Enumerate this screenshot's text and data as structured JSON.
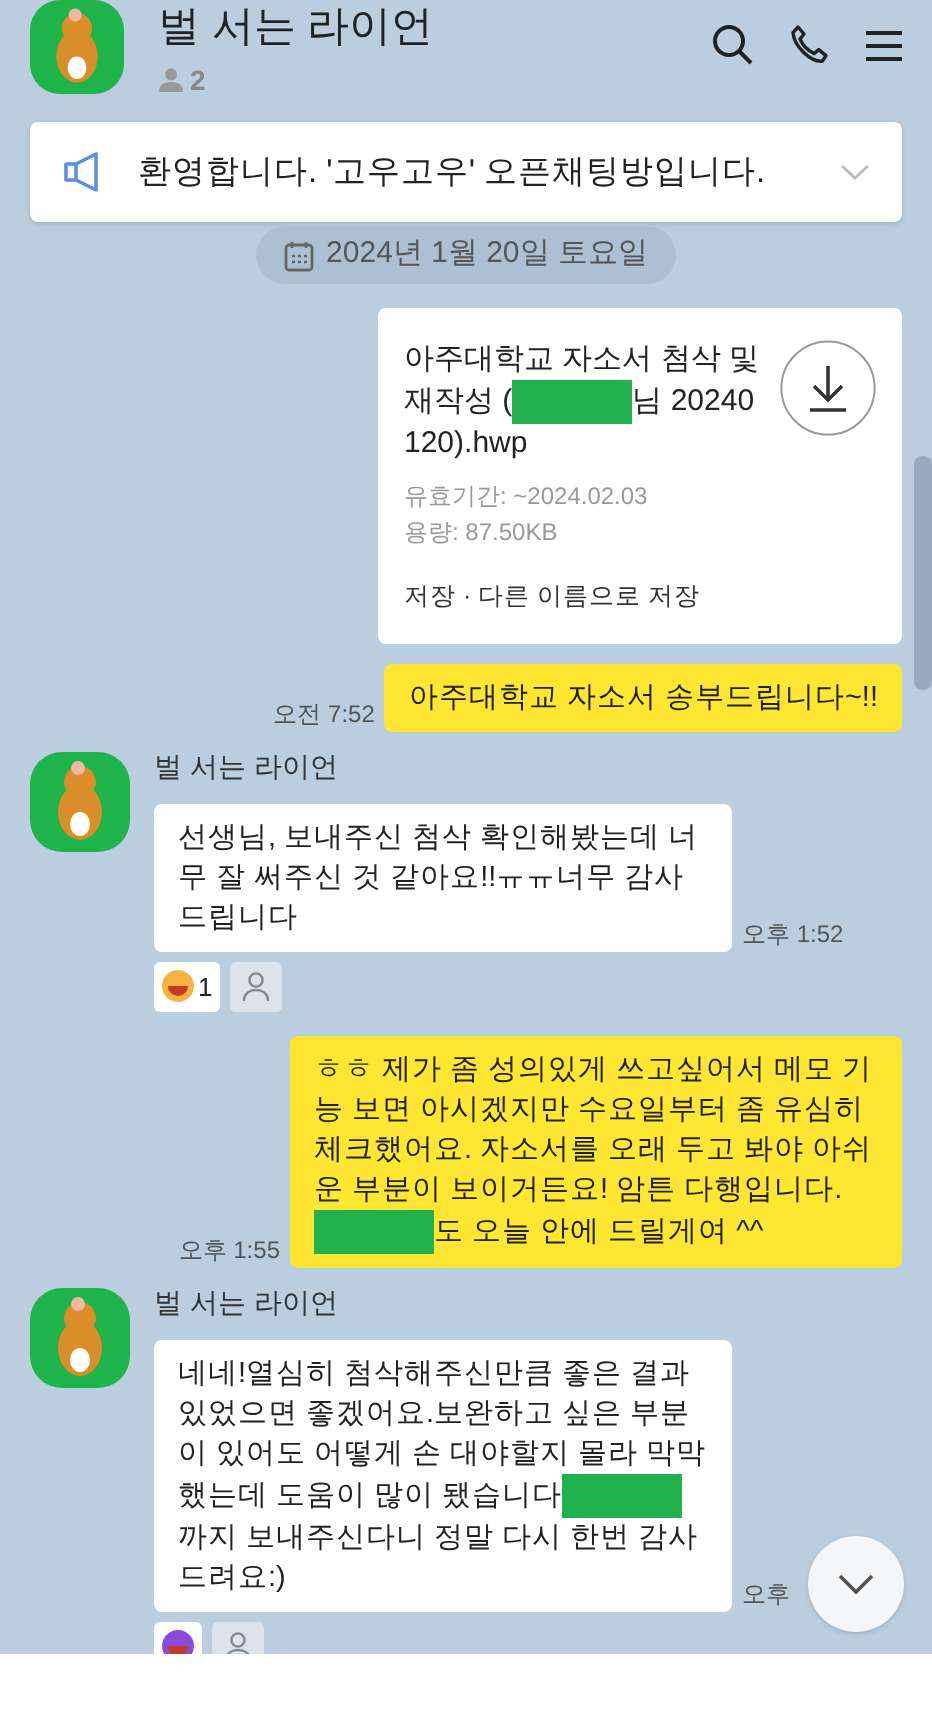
{
  "header": {
    "title": "벌 서는 라이언",
    "member_count": "2"
  },
  "notice": {
    "text": "환영합니다. '고우고우' 오픈채팅방입니다."
  },
  "date_divider": "2024년 1월 20일 토요일",
  "messages": [
    {
      "kind": "file",
      "mine": true,
      "file_name": [
        {
          "kind": "text",
          "text": "아주대학교 자소서 첨삭 및 재작성 ("
        },
        {
          "kind": "redacted"
        },
        {
          "kind": "text",
          "text": "님 20240120).hwp"
        }
      ],
      "expiry": "유효기간: ~2024.02.03",
      "size": "용량: 87.50KB",
      "actions": "저장 · 다른 이름으로 저장"
    },
    {
      "kind": "text",
      "mine": true,
      "text": [
        {
          "kind": "text",
          "text": "아주대학교 자소서 송부드립니다~!!"
        }
      ],
      "time": "오전 7:52"
    },
    {
      "kind": "text",
      "mine": false,
      "sender": "벌 서는 라이언",
      "text": [
        {
          "kind": "text",
          "text": "선생님, 보내주신 첨삭 확인해봤는데 너무 잘 써주신 것 같아요!!ㅠㅠ너무 감사드립니다"
        }
      ],
      "time": "오후 1:52",
      "reactions": [
        {
          "kind": "emoji",
          "count": "1"
        },
        {
          "kind": "add"
        }
      ]
    },
    {
      "kind": "text",
      "mine": true,
      "text": [
        {
          "kind": "text",
          "text": "ㅎㅎ 제가 좀 성의있게 쓰고싶어서   메모 기능 보면 아시겠지만 수요일부터 좀 유심히 체크했어요. 자소서를 오래 두고 봐야 아쉬운 부분이 보이거든요! 암튼 다행입니다. "
        },
        {
          "kind": "redacted"
        },
        {
          "kind": "text",
          "text": "도 오늘 안에 드릴게여 ^^"
        }
      ],
      "time": "오후 1:55"
    },
    {
      "kind": "text",
      "mine": false,
      "sender": "벌 서는 라이언",
      "text": [
        {
          "kind": "text",
          "text": "네네!열심히 첨삭해주신만큼 좋은 결과 있었으면 좋겠어요.보완하고 싶은 부분이 있어도 어떻게 손 대야할지 몰라 막막했는데 도움이 많이 됐습니다"
        },
        {
          "kind": "redacted"
        },
        {
          "kind": "text",
          "text": "까지 보내주신다니 정말 다시 한번 감사드려요:)"
        }
      ],
      "time": "오후",
      "reactions": [
        {
          "kind": "emoji"
        },
        {
          "kind": "add"
        }
      ]
    }
  ]
}
